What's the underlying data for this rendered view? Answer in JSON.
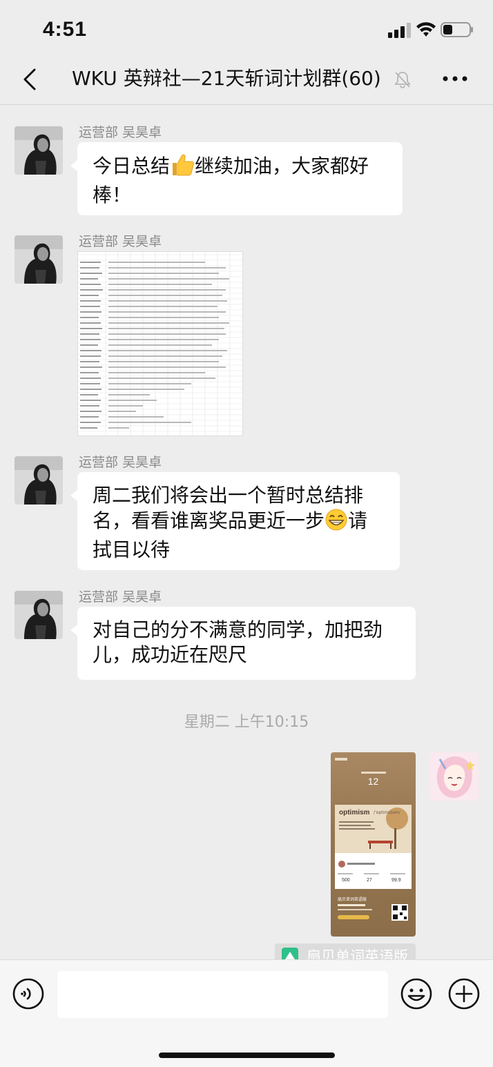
{
  "status": {
    "time": "4:51"
  },
  "header": {
    "title": "WKU 英辩社—21天斩词计划群(60)"
  },
  "messages": [
    {
      "sender": "运营部 吴昊卓",
      "text_a": "今日总结",
      "emoji": "thumbs-up",
      "text_b": "继续加油，大家都好棒！"
    },
    {
      "sender": "运营部 吴昊卓",
      "attachment": "spreadsheet-image"
    },
    {
      "sender": "运营部 吴昊卓",
      "text_a": "周二我们将会出一个暂时总结排名，看看谁离奖品更近一步",
      "emoji": "grinning-face",
      "text_b": "请拭目以待"
    },
    {
      "sender": "运营部 吴昊卓",
      "text": "对自己的分不满意的同学，加把劲儿，成功近在咫尺"
    }
  ],
  "timestamp": "星期二 上午10:15",
  "shared_card": {
    "days_count": "12",
    "word": "optimism",
    "phonetic": "/ˈɒptɪmɪzəm/",
    "stats": [
      "500",
      "27",
      "99.9"
    ],
    "app_name": "扇贝单词英语版"
  },
  "app_tag": "扇贝单词英语版",
  "colors": {
    "background": "#ededed",
    "bubble": "#ffffff",
    "meta": "#8a8a8a",
    "card": "#9b7b57"
  }
}
